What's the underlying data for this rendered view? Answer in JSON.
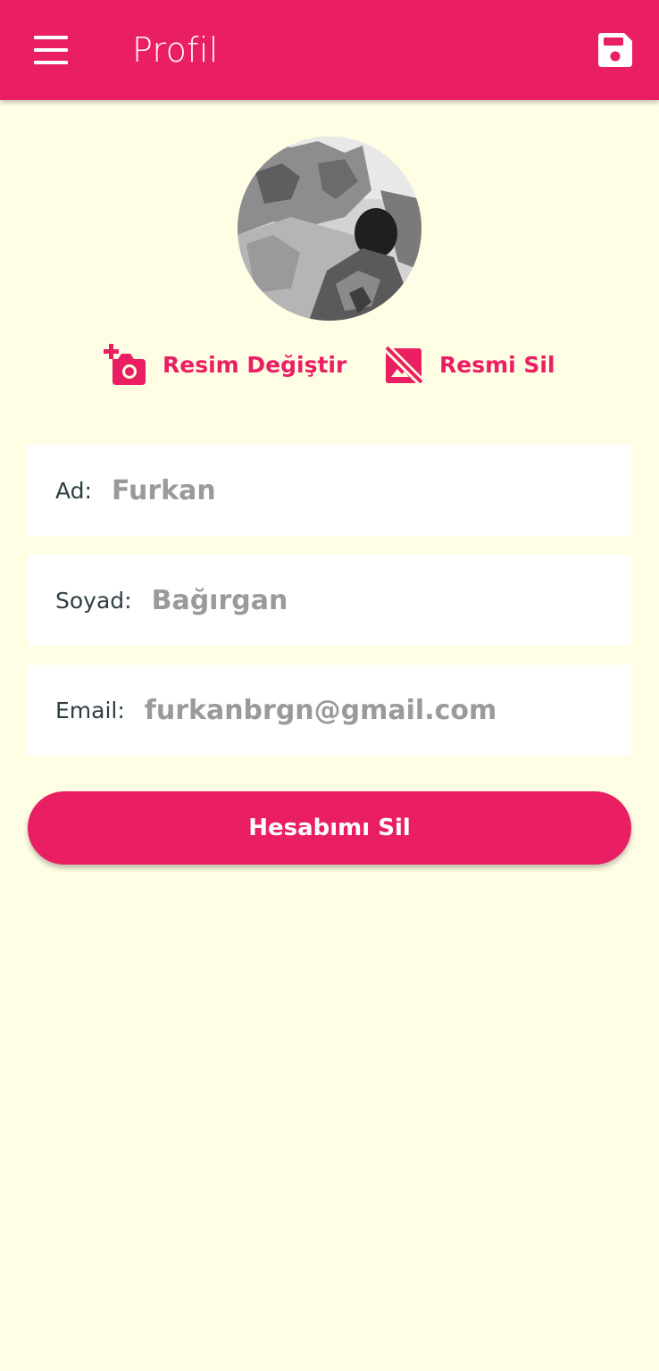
{
  "app_bar": {
    "title": "Profil",
    "menu_icon": "menu-icon",
    "save_icon": "save-icon",
    "color": "#E91E63"
  },
  "profile_photo": {
    "icon": "profile-photo"
  },
  "photo_actions": {
    "change_label": "Resim Değiştir",
    "change_icon": "add-a-photo-icon",
    "delete_label": "Resmi Sil",
    "delete_icon": "no-photography-icon"
  },
  "fields": [
    {
      "label": "Ad:",
      "value": "Furkan"
    },
    {
      "label": "Soyad:",
      "value": "Bağırgan"
    },
    {
      "label": "Email:",
      "value": "furkanbrgn@gmail.com"
    }
  ],
  "delete_account": {
    "label": "Hesabımı Sil"
  },
  "colors": {
    "accent": "#E91E63",
    "background": "#FFFDE4",
    "field_background": "#FFFFFF",
    "label_text": "#2D3E43",
    "value_text": "#9A9A9A"
  }
}
